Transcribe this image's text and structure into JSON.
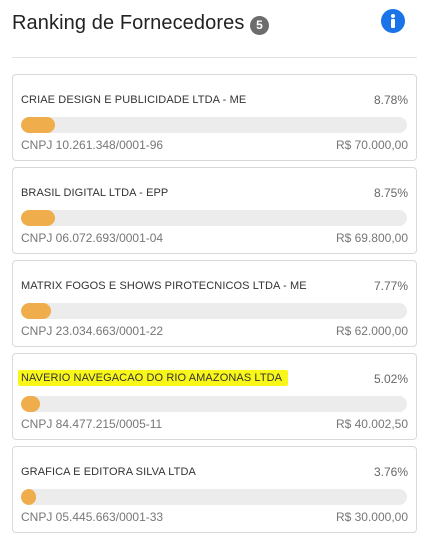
{
  "header": {
    "title": "Ranking de Fornecedores",
    "count": "5",
    "info_icon": "info-icon"
  },
  "colors": {
    "accent_bar": "#efad4b",
    "info_blue": "#1a73e8",
    "highlight": "#f9f71a"
  },
  "suppliers": [
    {
      "name": "CRIAE DESIGN E PUBLICIDADE LTDA - ME",
      "percent": "8.78%",
      "share": 0.0878,
      "cnpj": "CNPJ 10.261.348/0001-96",
      "value": "R$ 70.000,00",
      "highlighted": false
    },
    {
      "name": "BRASIL DIGITAL LTDA - EPP",
      "percent": "8.75%",
      "share": 0.0875,
      "cnpj": "CNPJ 06.072.693/0001-04",
      "value": "R$ 69.800,00",
      "highlighted": false
    },
    {
      "name": "MATRIX FOGOS E SHOWS PIROTECNICOS LTDA - ME",
      "percent": "7.77%",
      "share": 0.0777,
      "cnpj": "CNPJ 23.034.663/0001-22",
      "value": "R$ 62.000,00",
      "highlighted": false
    },
    {
      "name": "NAVERIO NAVEGACAO DO RIO AMAZONAS LTDA",
      "percent": "5.02%",
      "share": 0.0502,
      "cnpj": "CNPJ 84.477.215/0005-11",
      "value": "R$ 40.002,50",
      "highlighted": true
    },
    {
      "name": "GRAFICA E EDITORA SILVA LTDA",
      "percent": "3.76%",
      "share": 0.0376,
      "cnpj": "CNPJ 05.445.663/0001-33",
      "value": "R$ 30.000,00",
      "highlighted": false
    }
  ]
}
